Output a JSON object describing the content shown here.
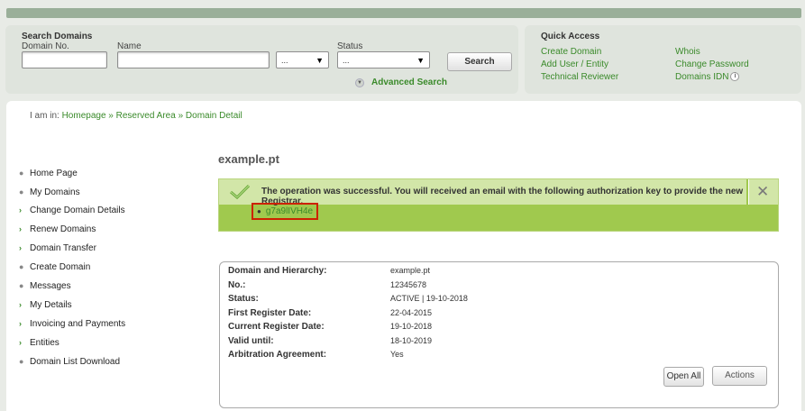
{
  "search": {
    "title": "Search Domains",
    "domain_no_label": "Domain No.",
    "name_label": "Name",
    "tld_select_value": "...",
    "status_label": "Status",
    "status_select_value": "...",
    "search_button": "Search",
    "advanced_search": "Advanced Search"
  },
  "quick_access": {
    "title": "Quick Access",
    "links": [
      "Create Domain",
      "Add User / Entity",
      "Technical Reviewer",
      "Whois",
      "Change Password",
      "Domains IDN"
    ]
  },
  "breadcrumb": {
    "prefix": "I am in:",
    "items": [
      "Homepage",
      "Reserved Area",
      "Domain Detail"
    ],
    "separator": "»"
  },
  "nav": {
    "items": [
      {
        "label": "Home Page",
        "marker": "bullet"
      },
      {
        "label": "My Domains",
        "marker": "bullet"
      },
      {
        "label": "Change Domain Details",
        "marker": "chevron"
      },
      {
        "label": "Renew Domains",
        "marker": "chevron"
      },
      {
        "label": "Domain Transfer",
        "marker": "chevron"
      },
      {
        "label": "Create Domain",
        "marker": "bullet"
      },
      {
        "label": "Messages",
        "marker": "bullet"
      },
      {
        "label": "My Details",
        "marker": "chevron"
      },
      {
        "label": "Invoicing and Payments",
        "marker": "chevron"
      },
      {
        "label": "Entities",
        "marker": "chevron"
      },
      {
        "label": "Domain List Download",
        "marker": "bullet"
      }
    ]
  },
  "page_title": "example.pt",
  "success": {
    "message": "The operation was successful. You will received an email with the following authorization key to provide the new Registrar.",
    "auth_key": "g7a9lIVH4e"
  },
  "details": {
    "rows": [
      {
        "label": "Domain and Hierarchy:",
        "value": "example.pt"
      },
      {
        "label": "No.:",
        "value": "12345678"
      },
      {
        "label": "Status:",
        "value": "ACTIVE | 19-10-2018"
      },
      {
        "label": "First Register Date:",
        "value": "22-04-2015"
      },
      {
        "label": "Current Register Date:",
        "value": "19-10-2018"
      },
      {
        "label": "Valid until:",
        "value": "18-10-2019"
      },
      {
        "label": "Arbitration Agreement:",
        "value": "Yes"
      }
    ],
    "open_all_button": "Open All",
    "actions_button": "Actions"
  },
  "colors": {
    "link_green": "#3a8a2a",
    "success_green": "#a0c94e",
    "highlight_red": "#cc2200"
  }
}
